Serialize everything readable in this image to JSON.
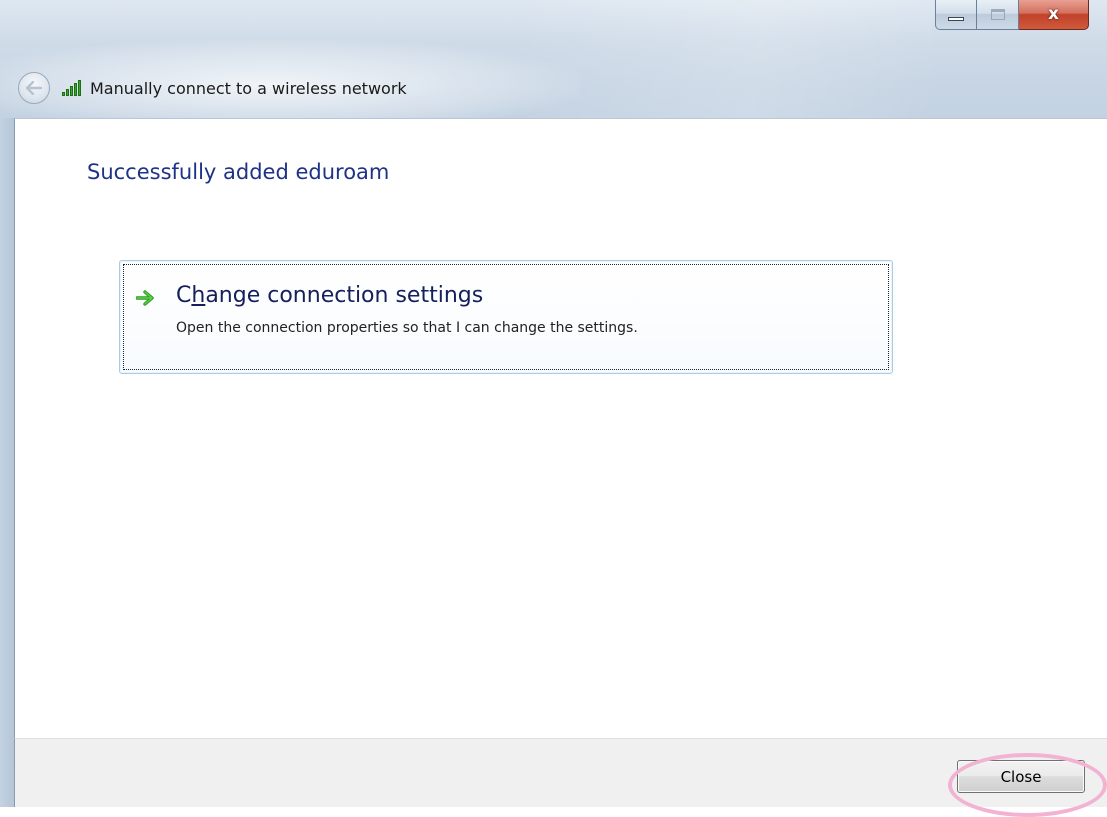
{
  "window": {
    "caption_buttons": {
      "minimize_icon": "minimize-glyph",
      "maximize_icon": "maximize-glyph",
      "close_icon": "close-x-glyph",
      "close_glyph": "x"
    },
    "nav": {
      "back_icon": "back-arrow-icon",
      "network_icon": "wireless-signal-icon",
      "title": "Manually connect to a wireless network"
    }
  },
  "content": {
    "heading": "Successfully added eduroam",
    "command_link": {
      "icon": "green-arrow-icon",
      "title_before": "C",
      "title_accel": "h",
      "title_after": "ange connection settings",
      "description": "Open the connection properties so that I can change the settings."
    }
  },
  "footer": {
    "close_label": "Close"
  },
  "colors": {
    "heading": "#1e3287",
    "command_title": "#15205a",
    "highlight_ring": "#f2b3d2",
    "signal_green": "#3aa52c"
  }
}
